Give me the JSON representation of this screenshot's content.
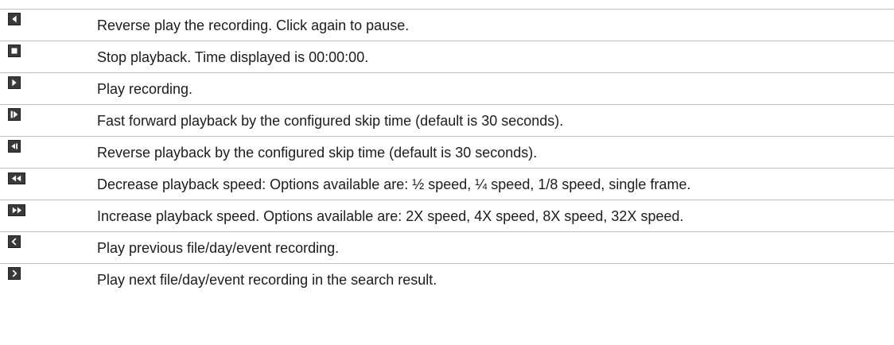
{
  "rows": [
    {
      "icon": "reverse-play-icon",
      "text": "Reverse play the recording. Click again to pause."
    },
    {
      "icon": "stop-icon",
      "text": "Stop playback. Time displayed is 00:00:00."
    },
    {
      "icon": "play-icon",
      "text": "Play recording."
    },
    {
      "icon": "skip-forward-icon",
      "text": "Fast forward playback by the configured skip time (default is 30 seconds)."
    },
    {
      "icon": "skip-backward-icon",
      "text": "Reverse playback by the configured skip time (default is 30 seconds)."
    },
    {
      "icon": "decrease-speed-icon",
      "text": "Decrease playback speed: Options available are: ½ speed, ¼ speed, 1/8 speed, single frame."
    },
    {
      "icon": "increase-speed-icon",
      "text": "Increase playback speed. Options available are: 2X speed, 4X speed, 8X speed, 32X speed."
    },
    {
      "icon": "previous-file-icon",
      "text": "Play previous file/day/event recording."
    },
    {
      "icon": "next-file-icon",
      "text": "Play next file/day/event recording in the search result."
    }
  ]
}
